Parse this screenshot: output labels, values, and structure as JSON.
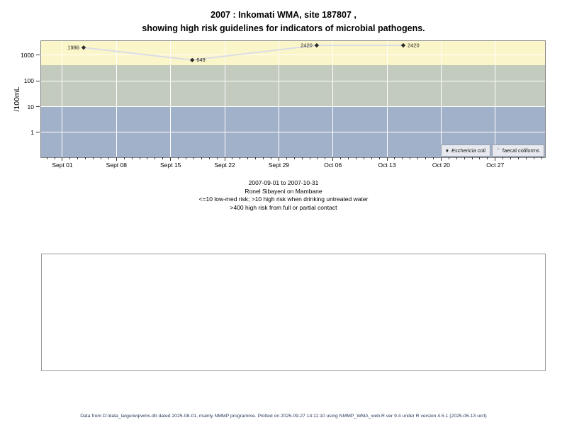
{
  "title": {
    "line1": "2007 : Inkomati WMA, site 187807 ,",
    "line2": "showing high risk guidelines for indicators of microbial pathogens."
  },
  "caption": {
    "lines": [
      "2007-09-01 to 2007-10-31",
      "Ronel Sibayeni on Mambane",
      "<=10 low-med risk; >10 high risk when drinking untreated water",
      ">400 high risk from full or partial contact"
    ]
  },
  "footer": {
    "text": "Data from D:/data_large/wq/wms.db dated 2025-08-01, mainly NMMP programme. Plotted on 2025-09-27 14:11:10 using NMMP_WMA_web.R ver 9.4 under R version 4.5.1 (2025-06-13 ucrt)"
  },
  "legend": {
    "items": [
      {
        "label": "Eschericia coli",
        "marker": "filled-diamond",
        "glyph": "♦"
      },
      {
        "label": "faecal coliforms",
        "marker": "open-circle",
        "glyph": "○"
      }
    ]
  },
  "chart_data": {
    "type": "line",
    "y_scale": "log",
    "ylabel": "/100mL",
    "ylim": [
      0.108,
      3550
    ],
    "xlim_days": [
      -2.75,
      62.44
    ],
    "x_tick_labels": [
      "Sept 01",
      "Sept 08",
      "Sept 15",
      "Sept 22",
      "Sept 29",
      "Oct 06",
      "Oct 13",
      "Oct 20",
      "Oct 27"
    ],
    "x_tick_days": [
      0,
      7,
      14,
      21,
      28,
      35,
      42,
      49,
      56
    ],
    "x_minor_tick_day_range": [
      -2,
      62
    ],
    "y_tick_values": [
      1000,
      100,
      10,
      1
    ],
    "y_tick_labels": [
      "1000",
      "100",
      "10",
      "1"
    ],
    "grid": true,
    "legend_position": "bottom-right",
    "bands": [
      {
        "name": "high risk from full or partial contact (>400)",
        "min": 400,
        "max": 3550,
        "color": "#fbf6c9"
      },
      {
        "name": "high risk when drinking untreated water (>10)",
        "min": 10,
        "max": 400,
        "color": "#c3cbbe"
      },
      {
        "name": "low-med risk (<=10)",
        "min": 0.108,
        "max": 10,
        "color": "#a2b1ca"
      }
    ],
    "series": [
      {
        "name": "Eschericia coli",
        "marker": "filled-diamond",
        "marker_color": "#2b2b2b",
        "line_color": "#dcdde4",
        "points": [
          {
            "day": 2.75,
            "value": 1986,
            "label": "1986",
            "label_side": "left"
          },
          {
            "day": 16.8,
            "value": 649,
            "label": "649",
            "label_side": "right"
          },
          {
            "day": 32.9,
            "value": 2420,
            "label": "2420",
            "label_side": "left"
          },
          {
            "day": 44.1,
            "value": 2420,
            "label": "2420",
            "label_side": "right"
          }
        ]
      },
      {
        "name": "faecal coliforms",
        "marker": "open-circle",
        "marker_color": "#2b2b2b",
        "line_color": "#dcdde4",
        "points": []
      }
    ]
  }
}
